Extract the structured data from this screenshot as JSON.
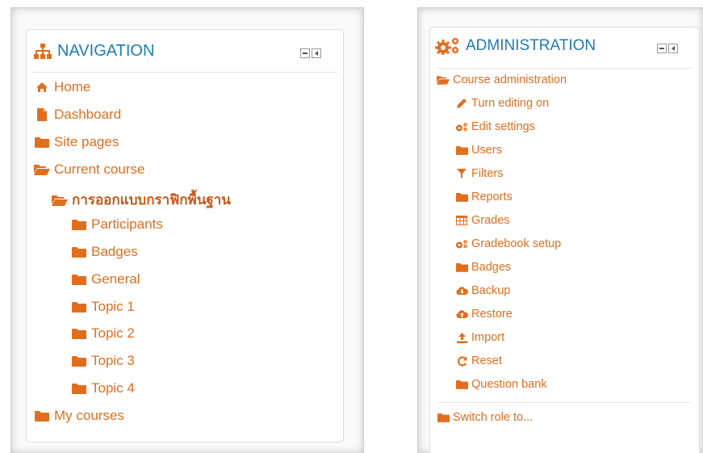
{
  "navigation": {
    "title": "NAVIGATION",
    "items": [
      {
        "label": "Home",
        "icon": "home-icon"
      },
      {
        "label": "Dashboard",
        "icon": "file-icon"
      },
      {
        "label": "Site pages",
        "icon": "folder-icon"
      },
      {
        "label": "Current course",
        "icon": "folder-open-icon"
      },
      {
        "label": "การออกแบบกราฟิกพื้นฐาน",
        "icon": "folder-open-icon"
      },
      {
        "label": "Participants",
        "icon": "folder-icon"
      },
      {
        "label": "Badges",
        "icon": "folder-icon"
      },
      {
        "label": "General",
        "icon": "folder-icon"
      },
      {
        "label": "Topic 1",
        "icon": "folder-icon"
      },
      {
        "label": "Topic 2",
        "icon": "folder-icon"
      },
      {
        "label": "Topic 3",
        "icon": "folder-icon"
      },
      {
        "label": "Topic 4",
        "icon": "folder-icon"
      },
      {
        "label": "My courses",
        "icon": "folder-icon"
      }
    ]
  },
  "administration": {
    "title": "ADMINISTRATION",
    "items": [
      {
        "label": "Course administration",
        "icon": "folder-open-icon"
      },
      {
        "label": "Turn editing on",
        "icon": "pencil-icon"
      },
      {
        "label": "Edit settings",
        "icon": "gears-icon"
      },
      {
        "label": "Users",
        "icon": "folder-icon"
      },
      {
        "label": "Filters",
        "icon": "filter-icon"
      },
      {
        "label": "Reports",
        "icon": "folder-icon"
      },
      {
        "label": "Grades",
        "icon": "table-icon"
      },
      {
        "label": "Gradebook setup",
        "icon": "gears-icon"
      },
      {
        "label": "Badges",
        "icon": "folder-icon"
      },
      {
        "label": "Backup",
        "icon": "cloud-download-icon"
      },
      {
        "label": "Restore",
        "icon": "cloud-upload-icon"
      },
      {
        "label": "Import",
        "icon": "upload-icon"
      },
      {
        "label": "Reset",
        "icon": "reset-icon"
      },
      {
        "label": "Question bank",
        "icon": "folder-icon"
      },
      {
        "label": "Switch role to...",
        "icon": "folder-icon"
      }
    ]
  },
  "colors": {
    "accent": "#e16e1f",
    "title": "#1f7bb6"
  }
}
